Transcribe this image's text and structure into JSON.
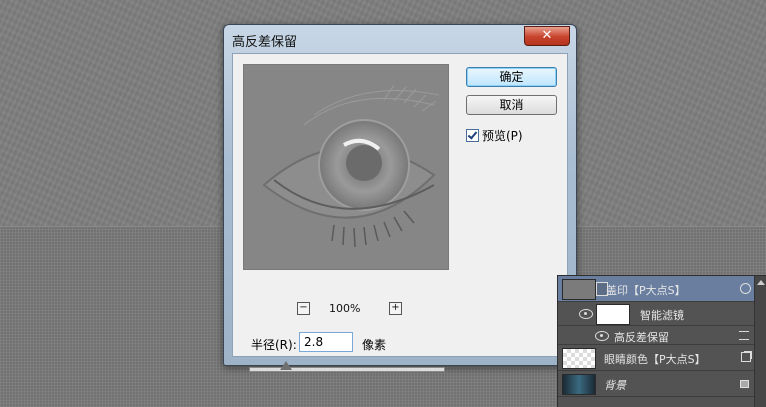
{
  "dialog": {
    "title": "高反差保留",
    "close_glyph": "✕",
    "ok_label": "确定",
    "cancel_label": "取消",
    "preview_label": "预览(P)",
    "preview_checked": true,
    "zoom_out_glyph": "−",
    "zoom_in_glyph": "+",
    "zoom_value": "100%",
    "radius_label": "半径(R):",
    "radius_value": "2.8",
    "radius_unit": "像素"
  },
  "layers_panel": {
    "rows": [
      {
        "name": "盖印【P大点S】",
        "selected": true,
        "icon": "smart-object-icon"
      },
      {
        "name": "智能滤镜",
        "icon": "eye-icon"
      },
      {
        "name": "高反差保留",
        "icon": "filter-options-icon"
      },
      {
        "name": "眼睛颜色【P大点S】",
        "icon": "copy-icon"
      },
      {
        "name": "背景",
        "icon": "lock-icon"
      }
    ]
  },
  "colors": {
    "canvas": "#7f7f7f",
    "dialog_frame": "#a9bdd2",
    "layers_bg": "#535353",
    "selected_layer": "#6a7fa0"
  }
}
